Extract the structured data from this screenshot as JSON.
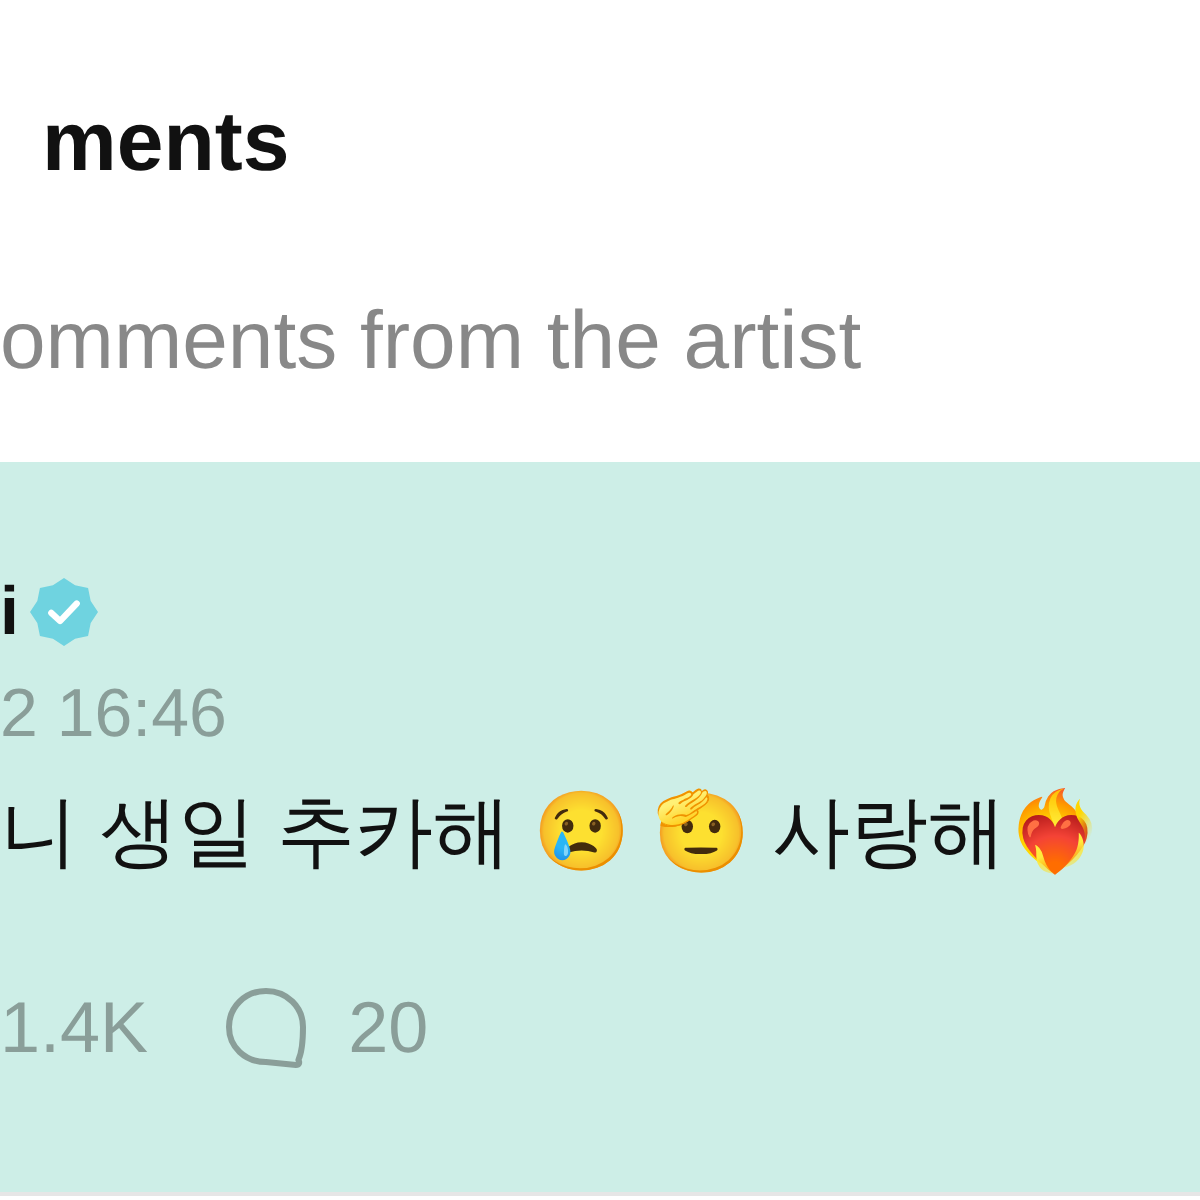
{
  "header": {
    "title": "ments",
    "subtitle": "omments from the artist"
  },
  "comment": {
    "author": "i",
    "verified": true,
    "time": "2 16:46",
    "text": "니 생일 추카해 😢 🫡 사랑해❤️‍🔥",
    "likes": "1.4K",
    "replies": "20"
  }
}
